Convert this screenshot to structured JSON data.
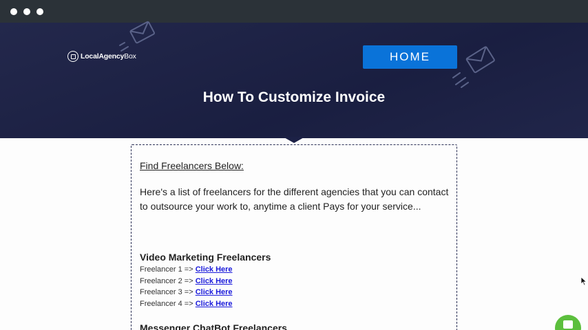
{
  "window": {
    "traffic_lights": [
      "window-dot",
      "window-dot",
      "window-dot"
    ]
  },
  "header": {
    "logo_text_main": "LocalAgency",
    "logo_text_light": "Box",
    "home_label": "HOME",
    "title": "How To Customize Invoice",
    "colors": {
      "background": "#1c2146",
      "button": "#0a73d9"
    }
  },
  "content": {
    "find_heading": "Find Freelancers Below:",
    "intro": "Here's a list of freelancers for the different agencies that you can contact to outsource your work to, anytime a client Pays for your service...",
    "sections": [
      {
        "title": "Video Marketing Freelancers",
        "rows": [
          {
            "label": "Freelancer 1 =>",
            "link": "Click Here"
          },
          {
            "label": "Freelancer 2 =>",
            "link": "Click Here"
          },
          {
            "label": "Freelancer 3 =>",
            "link": "Click Here"
          },
          {
            "label": "Freelancer 4 =>",
            "link": "Click Here"
          }
        ]
      },
      {
        "title": "Messenger ChatBot Freelancers"
      }
    ]
  },
  "widgets": {
    "chat_icon": "chat-icon",
    "chat_color": "#5cbf3d"
  }
}
